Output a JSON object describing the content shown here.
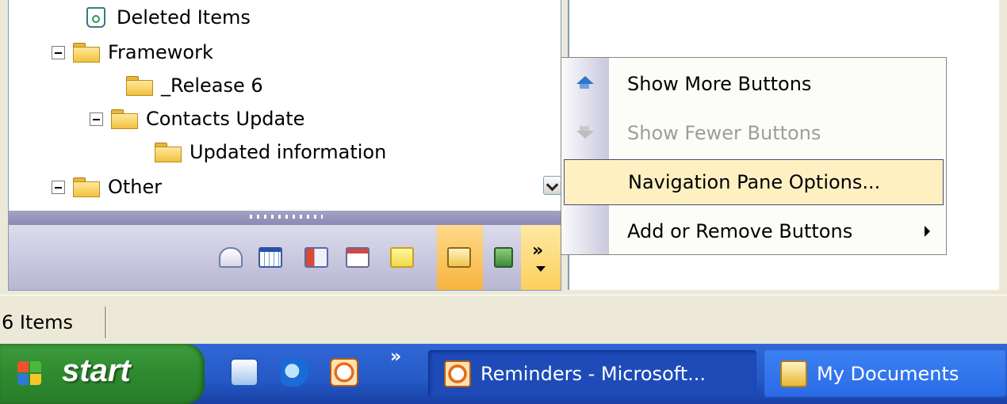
{
  "folder_tree": {
    "items": [
      {
        "label": "Deleted Items",
        "icon": "recycle-bin-icon"
      },
      {
        "label": "Framework",
        "icon": "folder-icon",
        "expanded": true
      },
      {
        "label": "_Release 6",
        "icon": "folder-icon"
      },
      {
        "label": "Contacts Update",
        "icon": "folder-icon",
        "expanded": true
      },
      {
        "label": "Updated information",
        "icon": "folder-icon"
      },
      {
        "label": "Other",
        "icon": "folder-icon",
        "expanded": true
      }
    ]
  },
  "nav_buttons": [
    "mail-icon",
    "calendar-icon",
    "contacts-icon",
    "tasks-icon",
    "notes-icon",
    "folder-list-icon",
    "shortcuts-icon"
  ],
  "nav_buttons_chevron": "»",
  "context_menu": {
    "items": [
      {
        "label": "Show More Buttons",
        "icon": "arrow-up-icon",
        "enabled": true
      },
      {
        "label": "Show Fewer Buttons",
        "icon": "arrow-down-icon",
        "enabled": false
      },
      {
        "label": "Navigation Pane Options...",
        "highlighted": true,
        "enabled": true
      },
      {
        "label": "Add or Remove Buttons",
        "has_submenu": true,
        "enabled": true
      }
    ]
  },
  "status_bar": {
    "text": "6 Items"
  },
  "taskbar": {
    "start_label": "start",
    "quick_launch": [
      "outlook-icon",
      "internet-explorer-icon",
      "reminders-icon"
    ],
    "quick_launch_chevron": "»",
    "tasks": [
      {
        "label": "Reminders - Microsoft...",
        "active": true,
        "icon": "reminder-clock-icon"
      },
      {
        "label": "My Documents",
        "active": false,
        "icon": "open-folder-icon"
      }
    ]
  },
  "colors": {
    "menu_highlight": "#fff0c2",
    "taskbar_blue": "#2459c6",
    "start_green": "#2f8a2f",
    "active_nav_button": "#f7b43e"
  }
}
